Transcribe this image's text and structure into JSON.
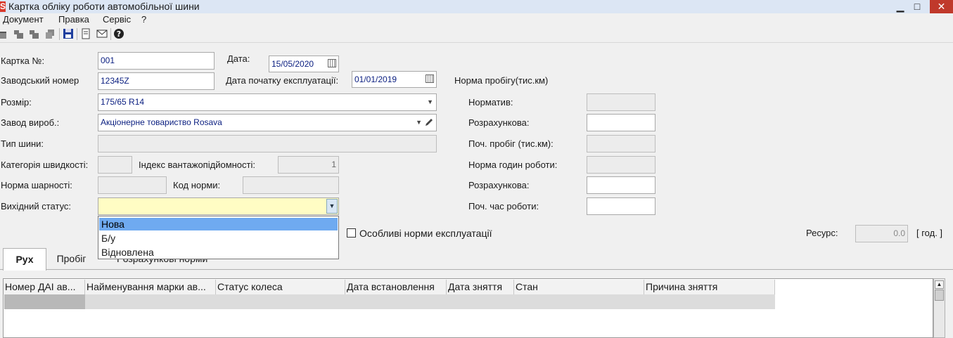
{
  "window": {
    "title": "Картка обліку роботи автомобільної шини",
    "app_icon_letter": "S",
    "min_glyph": "▁",
    "max_glyph": "□",
    "close_glyph": "✕"
  },
  "menu": [
    "Документ",
    "Правка",
    "Сервіс",
    "?"
  ],
  "toolbar": {
    "icons": [
      "new-doc-icon",
      "insert-doc-icon",
      "copy-doc-icon",
      "delete-doc-icon",
      "save-icon",
      "print-preview-icon",
      "mail-icon",
      "help-icon"
    ]
  },
  "form": {
    "card_no_label": "Картка №:",
    "card_no_value": "001",
    "date_label": "Дата:",
    "date_value": "15/05/2020",
    "serial_label": "Заводський номер",
    "serial_value": "12345Z",
    "start_date_label": "Дата початку експлуатації:",
    "start_date_value": "01/01/2019",
    "size_label": "Розмір:",
    "size_value": "175/65 R14",
    "manufacturer_label": "Завод вироб.:",
    "manufacturer_value": "Акціонерне товариство Rosava",
    "tire_type_label": "Тип шини:",
    "speed_cat_label": "Категорія швидкості:",
    "load_index_label": "Індекс вантажопідйомності:",
    "load_index_value": "1",
    "wear_norm_label": "Норма шарності:",
    "norm_code_label": "Код норми:",
    "status_label": "Вихідний статус:",
    "status_options": [
      "Нова",
      "Б/у",
      "Відновлена"
    ],
    "special_norms_label": "Особливі норми експлуатації",
    "resource_label": "Ресурс:",
    "resource_value": "0.0",
    "resource_unit": "[ год. ]"
  },
  "norms": {
    "section_label": "Норма пробігу(тис.км)",
    "normative_label": "Норматив:",
    "calc1_label": "Розрахункова:",
    "start_mileage_label": "Поч. пробіг (тис.км):",
    "hours_norm_label": "Норма годин роботи:",
    "calc2_label": "Розрахункова:",
    "start_time_label": "Поч. час роботи:"
  },
  "tabs": [
    "Рух",
    "Пробіг",
    "Розрахункові норми"
  ],
  "grid": {
    "columns": [
      "Номер ДАІ ав...",
      "Найменування марки ав...",
      "Статус колеса",
      "Дата встановлення",
      "Дата зняття",
      "Стан",
      "Причина зняття"
    ]
  }
}
